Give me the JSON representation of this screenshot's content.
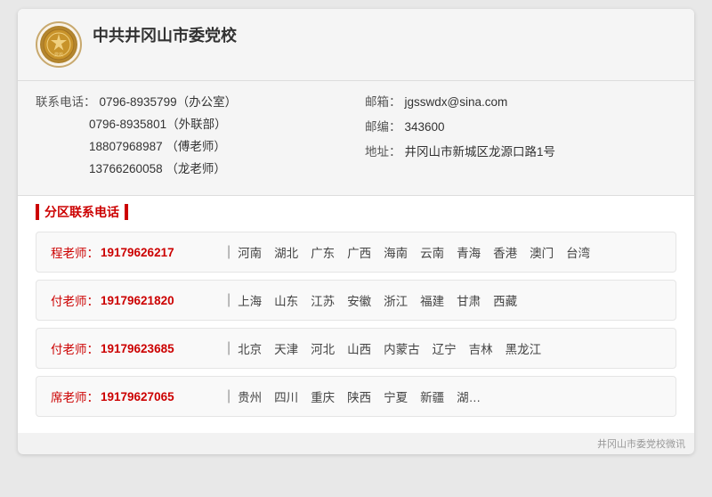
{
  "header": {
    "logo_text": "党校",
    "title": "中共井冈山市委党校"
  },
  "contact": {
    "phone_label": "联系电话：",
    "phone_main": "0796-8935799（办公室）",
    "phone_2": "0796-8935801（外联部）",
    "phone_3": "18807968987 （傅老师）",
    "phone_4": "13766260058 （龙老师）",
    "email_label": "邮箱：",
    "email_value": "jgsswdx@sina.com",
    "postal_label": "邮编：",
    "postal_value": "343600",
    "address_label": "地址：",
    "address_value": "井冈山市新城区龙源口路1号"
  },
  "section_title": "分区联系电话",
  "regional": [
    {
      "teacher": "程老师：",
      "phone": "19179626217",
      "regions": [
        "河南",
        "湖北",
        "广东",
        "广西",
        "海南",
        "云南",
        "青海",
        "香港",
        "澳门",
        "台湾"
      ]
    },
    {
      "teacher": "付老师：",
      "phone": "19179621820",
      "regions": [
        "上海",
        "山东",
        "江苏",
        "安徽",
        "浙江",
        "福建",
        "甘肃",
        "西藏"
      ]
    },
    {
      "teacher": "付老师：",
      "phone": "19179623685",
      "regions": [
        "北京",
        "天津",
        "河北",
        "山西",
        "内蒙古",
        "辽宁",
        "吉林",
        "黑龙江"
      ]
    },
    {
      "teacher": "席老师：",
      "phone": "19179627065",
      "regions": [
        "贵州",
        "四川",
        "重庆",
        "陕西",
        "宁夏",
        "新疆",
        "湖…"
      ]
    }
  ],
  "watermark": "井冈山市委党校微讯"
}
